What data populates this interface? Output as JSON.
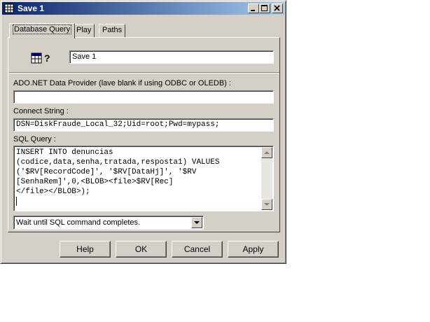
{
  "window": {
    "title": "Save 1",
    "title_icon": "grid-icon",
    "controls": [
      "minimize-icon",
      "maximize-icon",
      "close-icon"
    ]
  },
  "tabs": [
    {
      "label": "Database Query",
      "active": true
    },
    {
      "label": "Play",
      "active": false
    },
    {
      "label": "Paths",
      "active": false
    }
  ],
  "panel": {
    "action_icon": "database-query-icon",
    "name_value": "Save 1",
    "provider_label": "ADO.NET Data Provider (lave blank if using ODBC or OLEDB) :",
    "provider_value": "",
    "connect_label": "Connect String :",
    "connect_value": "DSN=DiskFraude_Local_32;Uid=root;Pwd=mypass;",
    "sql_label": "SQL Query :",
    "sql_lines": [
      "INSERT INTO denuncias",
      "(codice,data,senha,tratada,resposta1) VALUES",
      "('$RV[RecordCode]', '$RV[DataHj]', '$RV",
      "[SenhaRem]',0,<BLOB><file>$RV[Rec]",
      "</file></BLOB>);"
    ],
    "wait_option": "Wait until SQL command completes."
  },
  "buttons": {
    "help": "Help",
    "ok": "OK",
    "cancel": "Cancel",
    "apply": "Apply"
  },
  "colors": {
    "titlebar_start": "#0a246a",
    "titlebar_end": "#a6caf0",
    "face": "#d4d0c8"
  }
}
